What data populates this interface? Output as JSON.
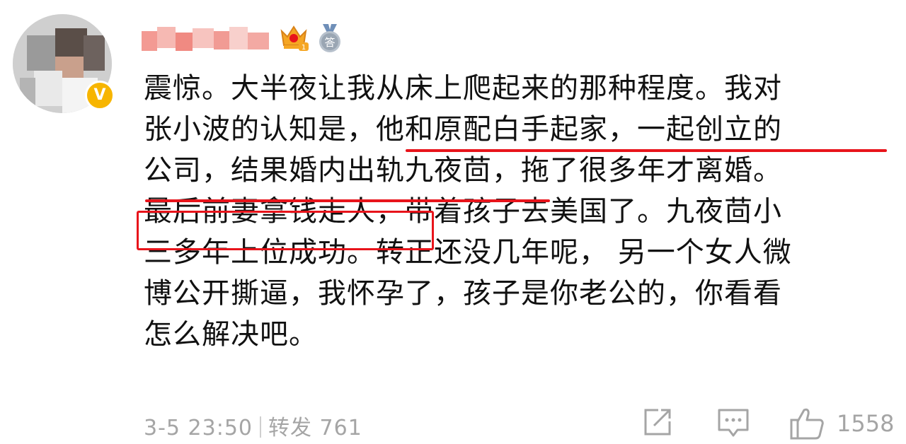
{
  "comment": {
    "lines": [
      "震惊。大半夜让我从床上爬起来的那种程度。我对",
      "张小波的认知是，他和原配白手起家，一起创立的",
      "公司，结果婚内出轨九夜茴，拖了很多年才离婚。",
      "最后前妻拿钱走人，带着孩子去美国了。九夜茴小",
      "三多年上位成功。转正还没几年呢， 另一个女人微",
      "博公开撕逼，我怀孕了，孩子是你老公的，你看看",
      "怎么解决吧。"
    ]
  },
  "footer": {
    "timestamp": "3-5 23:50",
    "repost_label": "转发",
    "repost_count": "761",
    "like_count": "1558"
  },
  "badges": {
    "verified_glyph": "V",
    "answer_glyph": "答"
  },
  "icons": [
    "verified-badge-icon",
    "crown-badge-icon",
    "answer-badge-icon",
    "share-icon",
    "comment-icon",
    "like-icon"
  ],
  "colors": {
    "annotation_red": "#e8141b",
    "verified_gold": "#f7b500",
    "muted_text": "#a5a5a5"
  }
}
